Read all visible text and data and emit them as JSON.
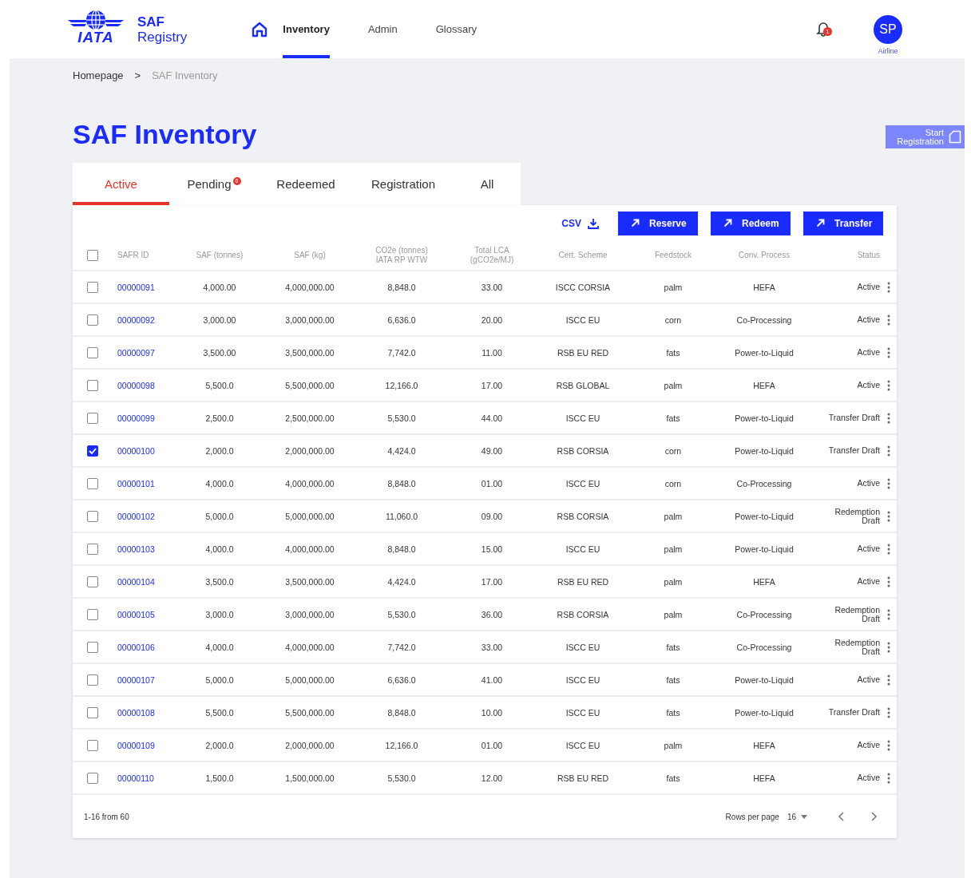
{
  "header": {
    "logo_text": "IATA",
    "app_name": [
      "SAF",
      "Registry"
    ],
    "nav": [
      {
        "label": "Inventory",
        "selected": true
      },
      {
        "label": "Admin",
        "selected": false
      },
      {
        "label": "Glossary",
        "selected": false
      }
    ],
    "notifications": "1",
    "avatar": "SP",
    "role": "Airline"
  },
  "breadcrumb": [
    "Homepage",
    ">",
    "SAF Inventory"
  ],
  "title": "SAF Inventory",
  "start_button": [
    "Start",
    "Registration"
  ],
  "tabs": [
    {
      "label": "Active",
      "selected": true
    },
    {
      "label": "Pending",
      "selected": false,
      "badge": "6"
    },
    {
      "label": "Redeemed",
      "selected": false
    },
    {
      "label": "Registration",
      "selected": false
    },
    {
      "label": "All",
      "selected": false
    }
  ],
  "toolbar": {
    "csv": "CSV",
    "buttons": [
      "Reserve",
      "Redeem",
      "Transfer"
    ]
  },
  "table": {
    "columns": [
      "SAFR ID",
      "SAF (tonnes)",
      "SAF (kg)",
      "CO2e (tonnes)\nIATA RP WTW",
      "Total LCA\n(gCO2e/MJ)",
      "Cert. Scheme",
      "Feedstock",
      "Conv. Process",
      "Status"
    ],
    "all_checked": false,
    "rows": [
      {
        "checked": false,
        "cells": [
          "00000091",
          "4,000.00",
          "4,000,000.00",
          "8,848.0",
          "33.00",
          "ISCC CORSIA",
          "palm",
          "HEFA",
          "Active"
        ]
      },
      {
        "checked": false,
        "cells": [
          "00000092",
          "3,000.00",
          "3,000,000.00",
          "6,636.0",
          "20.00",
          "ISCC EU",
          "corn",
          "Co-Processing",
          "Active"
        ]
      },
      {
        "checked": false,
        "cells": [
          "00000097",
          "3,500.00",
          "3,500,000.00",
          "7,742.0",
          "11.00",
          "RSB EU RED",
          "fats",
          "Power-to-Liquid",
          "Active"
        ]
      },
      {
        "checked": false,
        "cells": [
          "00000098",
          "5,500.0",
          "5,500,000.00",
          "12,166.0",
          "17.00",
          "RSB GLOBAL",
          "palm",
          "HEFA",
          "Active"
        ]
      },
      {
        "checked": false,
        "cells": [
          "00000099",
          "2,500.0",
          "2,500,000.00",
          "5,530.0",
          "44.00",
          "ISCC EU",
          "fats",
          "Power-to-Liquid",
          "Transfer Draft"
        ]
      },
      {
        "checked": true,
        "cells": [
          "00000100",
          "2,000.0",
          "2,000,000.00",
          "4,424.0",
          "49.00",
          "RSB CORSIA",
          "corn",
          "Power-to-Liquid",
          "Transfer Draft"
        ]
      },
      {
        "checked": false,
        "cells": [
          "00000101",
          "4,000.0",
          "4,000,000.00",
          "8,848.0",
          "01.00",
          "ISCC EU",
          "corn",
          "Co-Processing",
          "Active"
        ]
      },
      {
        "checked": false,
        "cells": [
          "00000102",
          "5,000.0",
          "5,000,000.00",
          "11,060.0",
          "09.00",
          "RSB CORSIA",
          "palm",
          "Power-to-Liquid",
          "Redemption Draft"
        ]
      },
      {
        "checked": false,
        "cells": [
          "00000103",
          "4,000.0",
          "4,000,000.00",
          "8,848.0",
          "15.00",
          "ISCC EU",
          "palm",
          "Power-to-Liquid",
          "Active"
        ]
      },
      {
        "checked": false,
        "cells": [
          "00000104",
          "3,500.0",
          "3,500,000.00",
          "4,424.0",
          "17.00",
          "RSB EU RED",
          "palm",
          "HEFA",
          "Active"
        ]
      },
      {
        "checked": false,
        "cells": [
          "00000105",
          "3,000.0",
          "3,000,000.00",
          "5,530.0",
          "36.00",
          "RSB CORSIA",
          "palm",
          "Co-Processing",
          "Redemption Draft"
        ]
      },
      {
        "checked": false,
        "cells": [
          "00000106",
          "4,000.0",
          "4,000,000.00",
          "7,742.0",
          "33.00",
          "ISCC EU",
          "fats",
          "Co-Processing",
          "Redemption Draft"
        ]
      },
      {
        "checked": false,
        "cells": [
          "00000107",
          "5,000.0",
          "5,000,000.00",
          "6,636.0",
          "41.00",
          "ISCC EU",
          "fats",
          "Power-to-Liquid",
          "Active"
        ]
      },
      {
        "checked": false,
        "cells": [
          "00000108",
          "5,500.0",
          "5,500,000.00",
          "8,848.0",
          "10.00",
          "ISCC EU",
          "fats",
          "Power-to-Liquid",
          "Transfer Draft"
        ]
      },
      {
        "checked": false,
        "cells": [
          "00000109",
          "2,000.0",
          "2,000,000.00",
          "12,166.0",
          "01.00",
          "ISCC EU",
          "palm",
          "HEFA",
          "Active"
        ]
      },
      {
        "checked": false,
        "cells": [
          "00000110",
          "1,500.0",
          "1,500,000.00",
          "5,530.0",
          "12.00",
          "RSB EU RED",
          "fats",
          "HEFA",
          "Active"
        ]
      }
    ]
  },
  "footer": {
    "range": "1-16 from 60",
    "rows_per_page_label": "Rows per page",
    "rows_per_page": "16"
  }
}
